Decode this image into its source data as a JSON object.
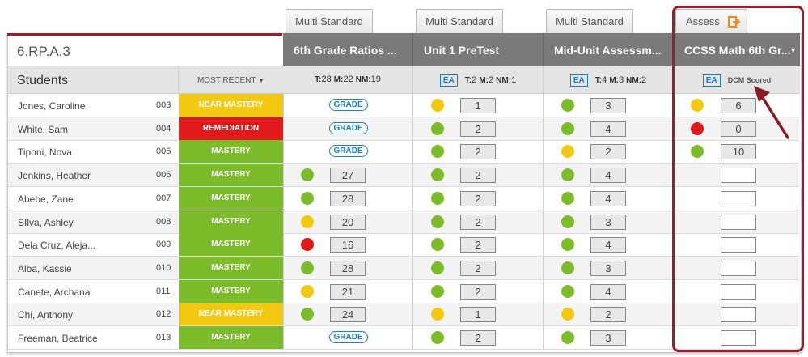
{
  "standard": "6.RP.A.3",
  "students_label": "Students",
  "sort_label": "MOST RECENT",
  "tabs": [
    "Multi Standard",
    "Multi Standard",
    "Multi Standard",
    "Assess"
  ],
  "columns": [
    {
      "title": "6th Grade Ratios ...",
      "ea": "",
      "counts": [
        {
          "k": "T:",
          "v": "28"
        },
        {
          "k": "M:",
          "v": "22"
        },
        {
          "k": "NM:",
          "v": "19"
        }
      ]
    },
    {
      "title": "Unit 1 PreTest",
      "ea": "EA",
      "counts": [
        {
          "k": "T:",
          "v": "2"
        },
        {
          "k": "M:",
          "v": "2"
        },
        {
          "k": "NM:",
          "v": "1"
        }
      ]
    },
    {
      "title": "Mid-Unit Assessm...",
      "ea": "EA",
      "counts": [
        {
          "k": "T:",
          "v": "4"
        },
        {
          "k": "M:",
          "v": "3"
        },
        {
          "k": "NM:",
          "v": "2"
        }
      ]
    },
    {
      "title": "CCSS Math 6th Gr...",
      "ea": "EA",
      "dcm": "DCM Scored"
    }
  ],
  "grade_label": "GRADE",
  "colors": {
    "mastery": "#7cbc2a",
    "near": "#f2c811",
    "remediation": "#e01a1a",
    "accent": "#9e1c2a",
    "link": "#1b7fc4"
  },
  "rows": [
    {
      "name": "Jones, Caroline",
      "id": "003",
      "status": "NEAR MASTERY",
      "status_class": "near",
      "scores": [
        {
          "type": "grade"
        },
        {
          "dot": "yellow",
          "val": "1"
        },
        {
          "dot": "green",
          "val": "3"
        },
        {
          "dot": "yellow",
          "val": "6"
        }
      ]
    },
    {
      "name": "White, Sam",
      "id": "004",
      "status": "REMEDIATION",
      "status_class": "rem",
      "scores": [
        {
          "type": "grade"
        },
        {
          "dot": "green",
          "val": "2"
        },
        {
          "dot": "green",
          "val": "4"
        },
        {
          "dot": "red",
          "val": "0"
        }
      ]
    },
    {
      "name": "Tiponi, Nova",
      "id": "005",
      "status": "MASTERY",
      "status_class": "mast",
      "scores": [
        {
          "type": "grade"
        },
        {
          "dot": "green",
          "val": "2"
        },
        {
          "dot": "yellow",
          "val": "2"
        },
        {
          "dot": "green",
          "val": "10"
        }
      ]
    },
    {
      "name": "Jenkins, Heather",
      "id": "006",
      "status": "MASTERY",
      "status_class": "mast",
      "scores": [
        {
          "dot": "green",
          "val": "27"
        },
        {
          "dot": "green",
          "val": "2"
        },
        {
          "dot": "green",
          "val": "4"
        },
        {
          "type": "empty"
        }
      ]
    },
    {
      "name": "Abebe, Zane",
      "id": "007",
      "status": "MASTERY",
      "status_class": "mast",
      "scores": [
        {
          "dot": "green",
          "val": "28"
        },
        {
          "dot": "green",
          "val": "2"
        },
        {
          "dot": "green",
          "val": "4"
        },
        {
          "type": "empty"
        }
      ]
    },
    {
      "name": "SIlva, Ashley",
      "id": "008",
      "status": "MASTERY",
      "status_class": "mast",
      "scores": [
        {
          "dot": "yellow",
          "val": "20"
        },
        {
          "dot": "green",
          "val": "2"
        },
        {
          "dot": "green",
          "val": "3"
        },
        {
          "type": "empty"
        }
      ]
    },
    {
      "name": "Dela Cruz, Aleja...",
      "id": "009",
      "status": "MASTERY",
      "status_class": "mast",
      "scores": [
        {
          "dot": "red",
          "val": "16"
        },
        {
          "dot": "green",
          "val": "2"
        },
        {
          "dot": "green",
          "val": "4"
        },
        {
          "type": "empty"
        }
      ]
    },
    {
      "name": "Alba, Kassie",
      "id": "010",
      "status": "MASTERY",
      "status_class": "mast",
      "scores": [
        {
          "dot": "green",
          "val": "28"
        },
        {
          "dot": "green",
          "val": "2"
        },
        {
          "dot": "green",
          "val": "3"
        },
        {
          "type": "empty"
        }
      ]
    },
    {
      "name": "Canete, Archana",
      "id": "011",
      "status": "MASTERY",
      "status_class": "mast",
      "scores": [
        {
          "dot": "yellow",
          "val": "21"
        },
        {
          "dot": "green",
          "val": "2"
        },
        {
          "dot": "green",
          "val": "4"
        },
        {
          "type": "empty"
        }
      ]
    },
    {
      "name": "Chi, Anthony",
      "id": "012",
      "status": "NEAR MASTERY",
      "status_class": "near",
      "scores": [
        {
          "dot": "green",
          "val": "24"
        },
        {
          "dot": "yellow",
          "val": "1"
        },
        {
          "dot": "yellow",
          "val": "2"
        },
        {
          "type": "empty"
        }
      ]
    },
    {
      "name": "Freeman, Beatrice",
      "id": "013",
      "status": "MASTERY",
      "status_class": "mast",
      "scores": [
        {
          "type": "grade"
        },
        {
          "dot": "green",
          "val": "2"
        },
        {
          "dot": "green",
          "val": "3"
        },
        {
          "type": "empty"
        }
      ]
    }
  ]
}
